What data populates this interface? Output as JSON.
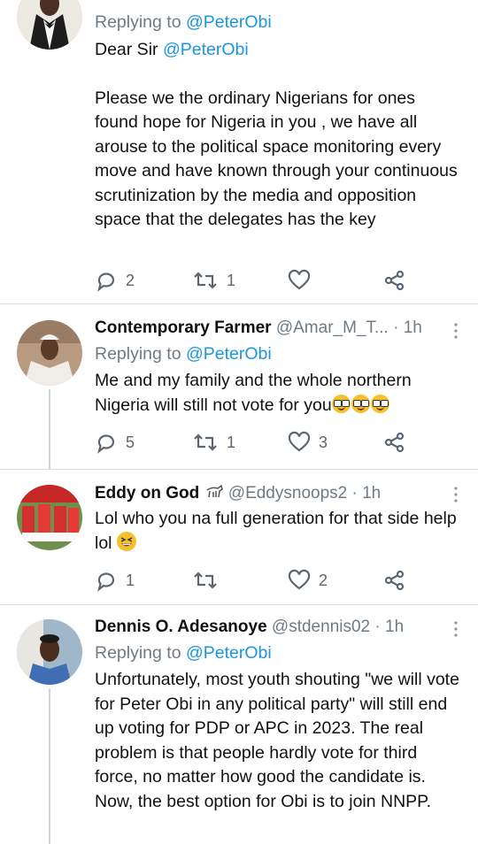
{
  "tweets": [
    {
      "replying_prefix": "Replying to ",
      "replying_handle": "@PeterObi",
      "body_intro": "Dear Sir ",
      "body_mention": "@PeterObi",
      "body_text": "Please we the ordinary Nigerians for ones found hope for Nigeria in you , we have all arouse to the political space monitoring every move and have known through your continuous scrutinization by the media and opposition space that the delegates has the key",
      "replies": "2",
      "retweets": "1",
      "likes": ""
    },
    {
      "name": "Contemporary Farmer",
      "handle": "@Amar_M_T...",
      "time": "· 1h",
      "replying_prefix": "Replying to ",
      "replying_handle": "@PeterObi",
      "body_text": "Me and my family and the whole northern Nigeria will still not vote for you",
      "body_emoji": "nerd-face-emoji x3",
      "replies": "5",
      "retweets": "1",
      "likes": "3"
    },
    {
      "name": "Eddy on God",
      "name_emoji": "goat-emoji",
      "handle": "@Eddysnoops2",
      "time": "· 1h",
      "body_text": "Lol who you na full generation for that side help lol",
      "body_emoji": "grinning-squinting-face-emoji",
      "replies": "1",
      "retweets": "",
      "likes": "2"
    },
    {
      "name": "Dennis O. Adesanoye",
      "handle": "@stdennis02",
      "time": "· 1h",
      "replying_prefix": "Replying to ",
      "replying_handle": "@PeterObi",
      "body_text": "Unfortunately, most youth shouting \"we will vote for Peter Obi in any political party\" will still end up voting for PDP or APC in 2023. The real problem is that people hardly vote for third force, no matter how good the candidate is.",
      "body_text2": "Now, the best option for Obi is to join NNPP."
    }
  ],
  "icons": {
    "reply": "reply-icon",
    "retweet": "retweet-icon",
    "like": "heart-icon",
    "share": "share-icon",
    "more": "more-vertical-icon"
  },
  "colors": {
    "link": "#1b95e0",
    "muted": "#6e7b86",
    "divider": "#d8dde2"
  }
}
